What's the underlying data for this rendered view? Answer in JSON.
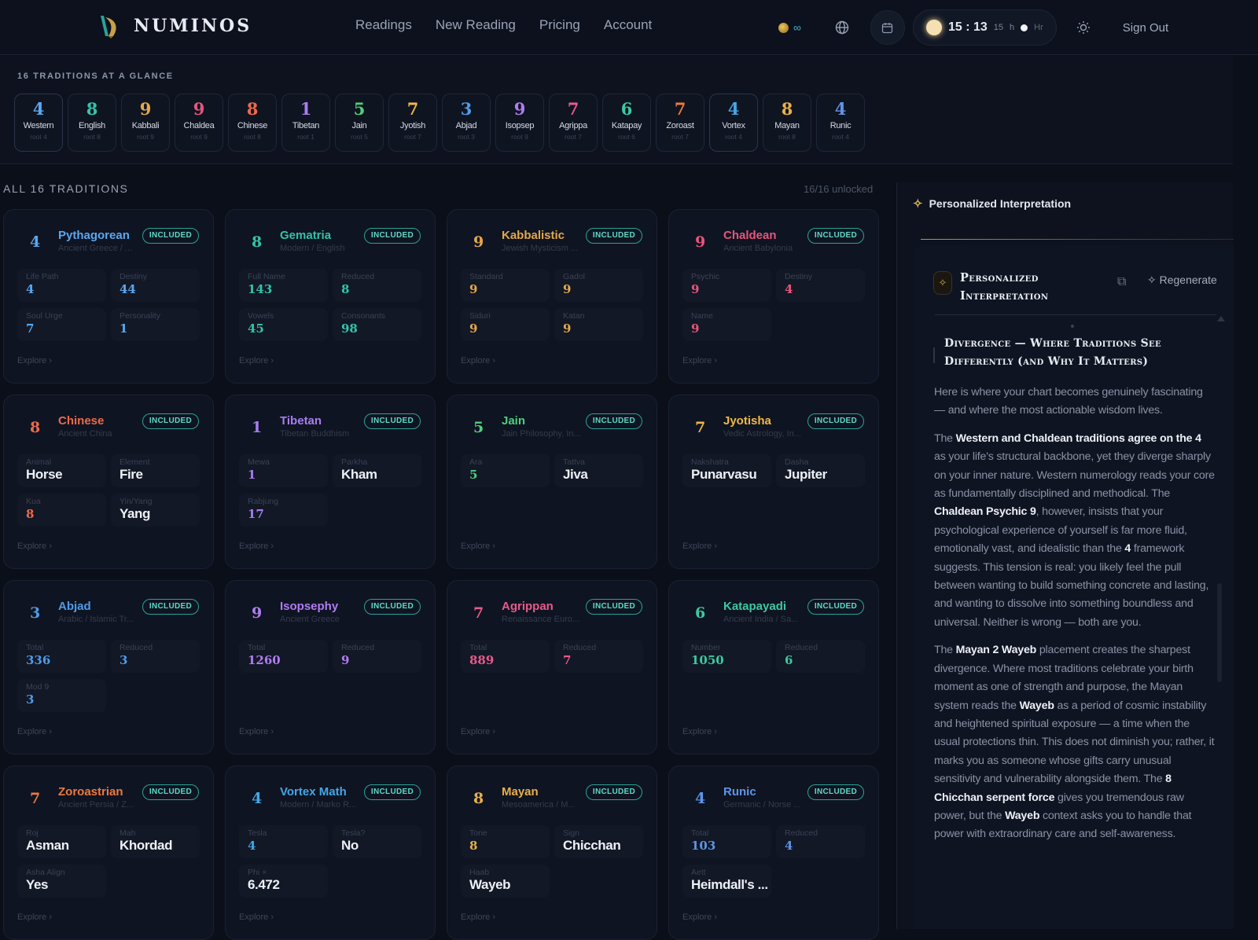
{
  "app": {
    "name": "NUMINOS"
  },
  "nav": [
    "Readings",
    "New Reading",
    "Pricing",
    "Account"
  ],
  "toolbar": {
    "credits": "∞",
    "clock_hm": "15 : 13",
    "clock_sec": "15",
    "clock_h": "h",
    "clock_hr": "Hr",
    "sign_out": "Sign Out"
  },
  "glance": {
    "title": "16 TRADITIONS AT A GLANCE",
    "chips": [
      {
        "n": "4",
        "name": "Western",
        "root": "root 4",
        "color": "#5aa8f0"
      },
      {
        "n": "8",
        "name": "English",
        "root": "root 8",
        "color": "#34c3a9"
      },
      {
        "n": "9",
        "name": "Kabbali",
        "root": "root 9",
        "color": "#e4a84a"
      },
      {
        "n": "9",
        "name": "Chaldea",
        "root": "root 9",
        "color": "#e8557a"
      },
      {
        "n": "8",
        "name": "Chinese",
        "root": "root 8",
        "color": "#ec6a4a"
      },
      {
        "n": "1",
        "name": "Tibetan",
        "root": "root 1",
        "color": "#a77ef0"
      },
      {
        "n": "5",
        "name": "Jain",
        "root": "root 5",
        "color": "#4fcf7c"
      },
      {
        "n": "7",
        "name": "Jyotish",
        "root": "root 7",
        "color": "#f2b84a"
      },
      {
        "n": "3",
        "name": "Abjad",
        "root": "root 3",
        "color": "#4f9be8"
      },
      {
        "n": "9",
        "name": "Isopsep",
        "root": "root 9",
        "color": "#b07cf0"
      },
      {
        "n": "7",
        "name": "Agrippa",
        "root": "root 7",
        "color": "#e85a8a"
      },
      {
        "n": "6",
        "name": "Katapay",
        "root": "root 6",
        "color": "#3cc9a0"
      },
      {
        "n": "7",
        "name": "Zoroast",
        "root": "root 7",
        "color": "#ec7a3e"
      },
      {
        "n": "4",
        "name": "Vortex",
        "root": "root 4",
        "color": "#44a6e6"
      },
      {
        "n": "8",
        "name": "Mayan",
        "root": "root 8",
        "color": "#e8b04a"
      },
      {
        "n": "4",
        "name": "Runic",
        "root": "root 4",
        "color": "#5f94e8"
      }
    ]
  },
  "traditions": {
    "title": "ALL 16 TRADITIONS",
    "unlocked": "16/16 unlocked",
    "badge": "INCLUDED",
    "explore": "Explore",
    "cards": [
      {
        "num": "4",
        "title": "Pythagorean",
        "sub": "Ancient Greece / ...",
        "color": "#5aa8f0",
        "fields": [
          {
            "label": "Life Path",
            "value": "4"
          },
          {
            "label": "Destiny",
            "value": "44"
          },
          {
            "label": "Soul Urge",
            "value": "7"
          },
          {
            "label": "Personality",
            "value": "1"
          }
        ]
      },
      {
        "num": "8",
        "title": "Gematria",
        "sub": "Modern / English",
        "color": "#34c3a9",
        "fields": [
          {
            "label": "Full Name",
            "value": "143"
          },
          {
            "label": "Reduced",
            "value": "8"
          },
          {
            "label": "Vowels",
            "value": "45"
          },
          {
            "label": "Consonants",
            "value": "98"
          }
        ]
      },
      {
        "num": "9",
        "title": "Kabbalistic",
        "sub": "Jewish Mysticism ...",
        "color": "#e4a84a",
        "fields": [
          {
            "label": "Standard",
            "value": "9"
          },
          {
            "label": "Gadol",
            "value": "9"
          },
          {
            "label": "Siduri",
            "value": "9"
          },
          {
            "label": "Katan",
            "value": "9"
          }
        ]
      },
      {
        "num": "9",
        "title": "Chaldean",
        "sub": "Ancient Babylonia",
        "color": "#e8557a",
        "fields": [
          {
            "label": "Psychic",
            "value": "9"
          },
          {
            "label": "Destiny",
            "value": "4"
          },
          {
            "label": "Name",
            "value": "9"
          }
        ]
      },
      {
        "num": "8",
        "title": "Chinese",
        "sub": "Ancient China",
        "color": "#ec6a4a",
        "fields": [
          {
            "label": "Animal",
            "value": "Horse",
            "text": true
          },
          {
            "label": "Element",
            "value": "Fire",
            "text": true
          },
          {
            "label": "Kua",
            "value": "8"
          },
          {
            "label": "Yin/Yang",
            "value": "Yang",
            "text": true
          }
        ]
      },
      {
        "num": "1",
        "title": "Tibetan",
        "sub": "Tibetan Buddhism",
        "color": "#a77ef0",
        "fields": [
          {
            "label": "Mewa",
            "value": "1"
          },
          {
            "label": "Parkha",
            "value": "Kham",
            "text": true
          },
          {
            "label": "Rabjung",
            "value": "17"
          }
        ]
      },
      {
        "num": "5",
        "title": "Jain",
        "sub": "Jain Philosophy, In...",
        "color": "#4fcf7c",
        "fields": [
          {
            "label": "Ara",
            "value": "5"
          },
          {
            "label": "Tattva",
            "value": "Jiva",
            "text": true
          }
        ]
      },
      {
        "num": "7",
        "title": "Jyotisha",
        "sub": "Vedic Astrology, In...",
        "color": "#f2b84a",
        "fields": [
          {
            "label": "Nakshatra",
            "value": "Punarvasu",
            "text": true
          },
          {
            "label": "Dasha",
            "value": "Jupiter",
            "text": true
          }
        ]
      },
      {
        "num": "3",
        "title": "Abjad",
        "sub": "Arabic / Islamic Tr...",
        "color": "#4f9be8",
        "fields": [
          {
            "label": "Total",
            "value": "336"
          },
          {
            "label": "Reduced",
            "value": "3"
          },
          {
            "label": "Mod 9",
            "value": "3"
          }
        ]
      },
      {
        "num": "9",
        "title": "Isopsephy",
        "sub": "Ancient Greece",
        "color": "#b07cf0",
        "fields": [
          {
            "label": "Total",
            "value": "1260"
          },
          {
            "label": "Reduced",
            "value": "9"
          }
        ]
      },
      {
        "num": "7",
        "title": "Agrippan",
        "sub": "Renaissance Euro...",
        "color": "#e85a8a",
        "fields": [
          {
            "label": "Total",
            "value": "889"
          },
          {
            "label": "Reduced",
            "value": "7"
          }
        ]
      },
      {
        "num": "6",
        "title": "Katapayadi",
        "sub": "Ancient India / Sa...",
        "color": "#3cc9a0",
        "fields": [
          {
            "label": "Number",
            "value": "1050"
          },
          {
            "label": "Reduced",
            "value": "6"
          }
        ]
      },
      {
        "num": "7",
        "title": "Zoroastrian",
        "sub": "Ancient Persia / Z...",
        "color": "#ec7a3e",
        "fields": [
          {
            "label": "Roj",
            "value": "Asman",
            "text": true
          },
          {
            "label": "Mah",
            "value": "Khordad",
            "text": true
          },
          {
            "label": "Asha Align",
            "value": "Yes",
            "text": true
          }
        ]
      },
      {
        "num": "4",
        "title": "Vortex Math",
        "sub": "Modern / Marko R...",
        "color": "#44a6e6",
        "fields": [
          {
            "label": "Tesla",
            "value": "4"
          },
          {
            "label": "Tesla?",
            "value": "No",
            "text": true
          },
          {
            "label": "Phi ×",
            "value": "6.472",
            "text": true
          }
        ]
      },
      {
        "num": "8",
        "title": "Mayan",
        "sub": "Mesoamerica / M...",
        "color": "#e8b04a",
        "fields": [
          {
            "label": "Tone",
            "value": "8"
          },
          {
            "label": "Sign",
            "value": "Chicchan",
            "text": true
          },
          {
            "label": "Haab",
            "value": "Wayeb",
            "text": true
          }
        ]
      },
      {
        "num": "4",
        "title": "Runic",
        "sub": "Germanic / Norse ...",
        "color": "#5f94e8",
        "fields": [
          {
            "label": "Total",
            "value": "103"
          },
          {
            "label": "Reduced",
            "value": "4"
          },
          {
            "label": "Aett",
            "value": "Heimdall's ...",
            "text": true
          }
        ]
      }
    ]
  },
  "panel": {
    "header": "Personalized Interpretation",
    "inner_title": "Personalized Interpretation",
    "regenerate": "Regenerate",
    "section_title": "Divergence — Where Traditions See Differently (and Why It Matters)",
    "paragraphs": [
      [
        {
          "t": "Here is where your chart becomes genuinely fascinating — and where the most actionable wisdom lives."
        }
      ],
      [
        {
          "t": "The "
        },
        {
          "t": "Western and Chaldean traditions agree on the 4",
          "b": true
        },
        {
          "t": " as your life's structural backbone, yet they diverge sharply on your inner nature. Western numerology reads your core as fundamentally disciplined and methodical. The "
        },
        {
          "t": "Chaldean Psychic 9",
          "b": true
        },
        {
          "t": ", however, insists that your psychological experience of yourself is far more fluid, emotionally vast, and idealistic than the "
        },
        {
          "t": "4",
          "b": true
        },
        {
          "t": " framework suggests. This tension is real: you likely feel the pull between wanting to build something concrete and lasting, and wanting to dissolve into something boundless and universal. Neither is wrong — both are you."
        }
      ],
      [
        {
          "t": "The "
        },
        {
          "t": "Mayan 2 Wayeb",
          "b": true
        },
        {
          "t": " placement creates the sharpest divergence. Where most traditions celebrate your birth moment as one of strength and purpose, the Mayan system reads the "
        },
        {
          "t": "Wayeb",
          "b": true
        },
        {
          "t": " as a period of cosmic instability and heightened spiritual exposure — a time when the usual protections thin. This does not diminish you; rather, it marks you as someone whose gifts carry unusual sensitivity and vulnerability alongside them. The "
        },
        {
          "t": "8 Chicchan serpent force",
          "b": true
        },
        {
          "t": " gives you tremendous raw power, but the "
        },
        {
          "t": "Wayeb",
          "b": true
        },
        {
          "t": " context asks you to handle that power with extraordinary care and self-awareness."
        }
      ]
    ]
  }
}
